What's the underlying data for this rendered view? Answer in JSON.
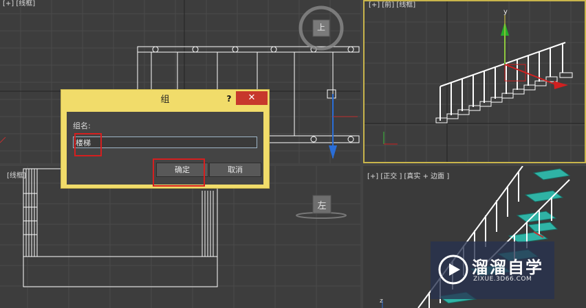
{
  "viewports": {
    "top_left": {
      "label": "[+] [线框]",
      "navcube_face": "上"
    },
    "top_right": {
      "label": "[+] [前] [线框]",
      "gizmo_axis": "y"
    },
    "bottom_left": {
      "label": "[线框]",
      "navcube_face": "左"
    },
    "bottom_right": {
      "label": "[+] [正交 ] [真实 + 边面 ]",
      "axis_z": "z"
    }
  },
  "group_dialog": {
    "title": "组",
    "help_label": "?",
    "close_label": "✕",
    "name_label": "组名:",
    "name_value": "楼梯",
    "ok_label": "确定",
    "cancel_label": "取消"
  },
  "watermark": {
    "title": "溜溜自学",
    "url": "ZIXUE.3D66.COM"
  },
  "colors": {
    "viewport_bg": "#3d3d3d",
    "dialog_bg": "#f1dc6a",
    "highlight": "#d61f1f",
    "close_button": "#c7382c",
    "stair_fill": "#2fb3a5"
  }
}
